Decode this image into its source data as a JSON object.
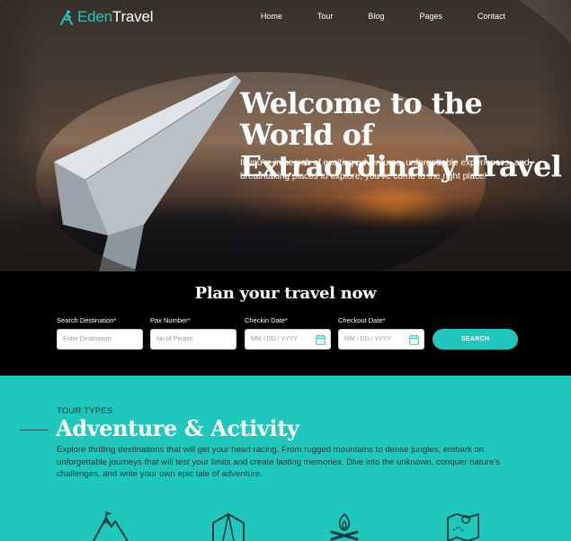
{
  "brand": {
    "name_part1": "Eden",
    "name_part2": "Travel",
    "accent_color": "#1fc7bc"
  },
  "nav": {
    "items": [
      "Home",
      "Tour",
      "Blog",
      "Pages",
      "Contact"
    ]
  },
  "hero": {
    "title": "Welcome to the World of Extraordinary Travel",
    "subtitle": "If you're in search of exciting adventures, unforgettable experiences, and breathtaking places to explore, you've come to the right place!"
  },
  "plan": {
    "title": "Plan your travel now",
    "fields": [
      {
        "label": "Search Destination*",
        "placeholder": "Enter Destination",
        "icon": ""
      },
      {
        "label": "Pax Number*",
        "placeholder": "No.of People",
        "icon": ""
      },
      {
        "label": "Checkin Date*",
        "placeholder": "MM / DD / YYYY",
        "icon": "calendar-icon"
      },
      {
        "label": "Checkout Date*",
        "placeholder": "MM / DD / YYYY",
        "icon": "calendar-icon"
      }
    ],
    "search_label": "SEARCH"
  },
  "tour": {
    "eyebrow": "TOUR TYPES",
    "title": "Adventure & Activity",
    "description": "Explore thrilling destinations that will get your heart racing. From rugged mountains to dense jungles, embark on unforgettable journeys that will test your limits and create lasting memories. Dive into the unknown, conquer nature's challenges, and write your own epic tale of adventure.",
    "icons": [
      "mountain-icon",
      "tent-icon",
      "campfire-icon",
      "map-pin-icon"
    ]
  }
}
